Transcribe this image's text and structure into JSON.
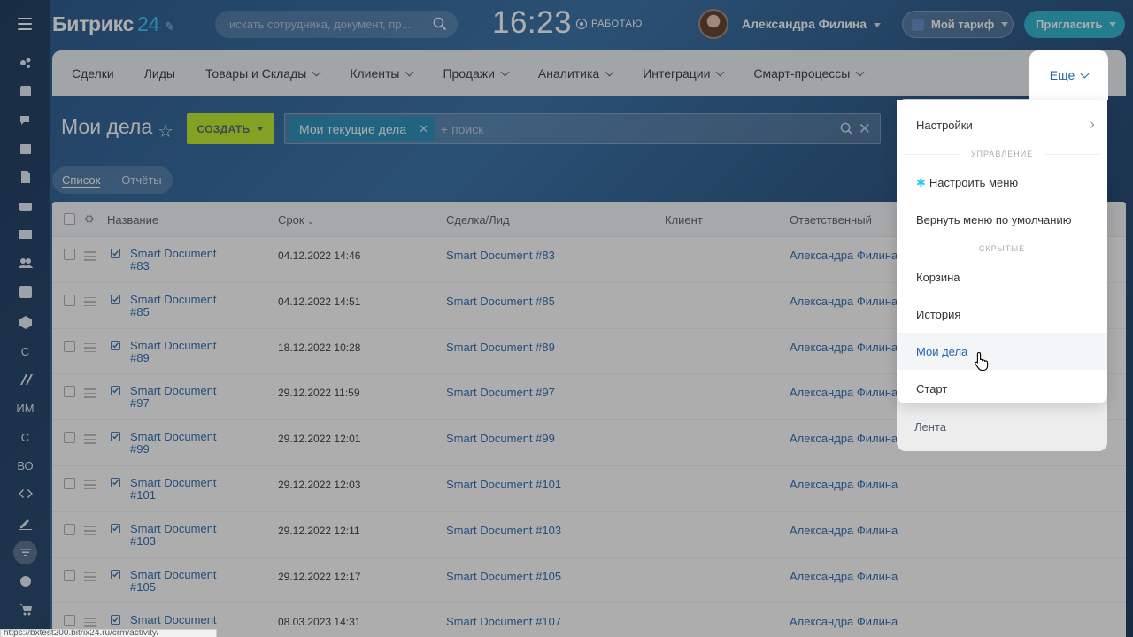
{
  "header": {
    "logo_text": "Битрикс",
    "logo_number": "24",
    "search_placeholder": "искать сотрудника, документ, пр...",
    "clock": "16:23",
    "work_status": "РАБОТАЮ",
    "user_name": "Александра Филина",
    "tariff_label": "Мой тариф",
    "invite_label": "Пригласить"
  },
  "left_rail": {
    "text_items": [
      "С",
      "ИМ",
      "С",
      "ВО"
    ]
  },
  "menu": {
    "items": [
      "Сделки",
      "Лиды",
      "Товары и Склады",
      "Клиенты",
      "Продажи",
      "Аналитика",
      "Интеграции",
      "Смарт-процессы"
    ],
    "more_label": "Еще"
  },
  "page": {
    "title": "Мои дела",
    "create_label": "СОЗДАТЬ",
    "filter_tag": "Мои текущие дела",
    "filter_search_placeholder": "+ поиск",
    "view_list": "Список",
    "view_reports": "Отчёты"
  },
  "table": {
    "columns": [
      "Название",
      "Срок",
      "Сделка/Лид",
      "Клиент",
      "Ответственный"
    ],
    "rows": [
      {
        "name_line1": "Smart Document",
        "name_line2": "#83",
        "date": "04.12.2022 14:46",
        "deal": "Smart Document #83",
        "responsible": "Александра Филина"
      },
      {
        "name_line1": "Smart Document",
        "name_line2": "#85",
        "date": "04.12.2022 14:51",
        "deal": "Smart Document #85",
        "responsible": "Александра Филина"
      },
      {
        "name_line1": "Smart Document",
        "name_line2": "#89",
        "date": "18.12.2022 10:28",
        "deal": "Smart Document #89",
        "responsible": "Александра Филина"
      },
      {
        "name_line1": "Smart Document",
        "name_line2": "#97",
        "date": "29.12.2022 11:59",
        "deal": "Smart Document #97",
        "responsible": "Александра Филина"
      },
      {
        "name_line1": "Smart Document",
        "name_line2": "#99",
        "date": "29.12.2022 12:01",
        "deal": "Smart Document #99",
        "responsible": "Александра Филина"
      },
      {
        "name_line1": "Smart Document",
        "name_line2": "#101",
        "date": "29.12.2022 12:03",
        "deal": "Smart Document #101",
        "responsible": "Александра Филина"
      },
      {
        "name_line1": "Smart Document",
        "name_line2": "#103",
        "date": "29.12.2022 12:11",
        "deal": "Smart Document #103",
        "responsible": "Александра Филина"
      },
      {
        "name_line1": "Smart Document",
        "name_line2": "#105",
        "date": "29.12.2022 12:17",
        "deal": "Smart Document #105",
        "responsible": "Александра Филина"
      },
      {
        "name_line1": "Smart Document",
        "name_line2": "",
        "date": "08.03.2023 14:31",
        "deal": "Smart Document #107",
        "responsible": "Александра Филина"
      }
    ]
  },
  "dropdown": {
    "settings": "Настройки",
    "section_manage": "УПРАВЛЕНИЕ",
    "configure_menu": "Настроить меню",
    "reset_menu": "Вернуть меню по умолчанию",
    "section_hidden": "СКРЫТЫЕ",
    "trash": "Корзина",
    "history": "История",
    "my_activities": "Мои дела",
    "start": "Старт",
    "feed": "Лента"
  },
  "status_bar_url": "https://bxtest200.bitrix24.ru/crm/activity/",
  "colors": {
    "accent_link": "#2066b0",
    "create_button": "#bbed21",
    "invite_button": "#22b0cf",
    "filter_tag": "#1d89b8"
  }
}
